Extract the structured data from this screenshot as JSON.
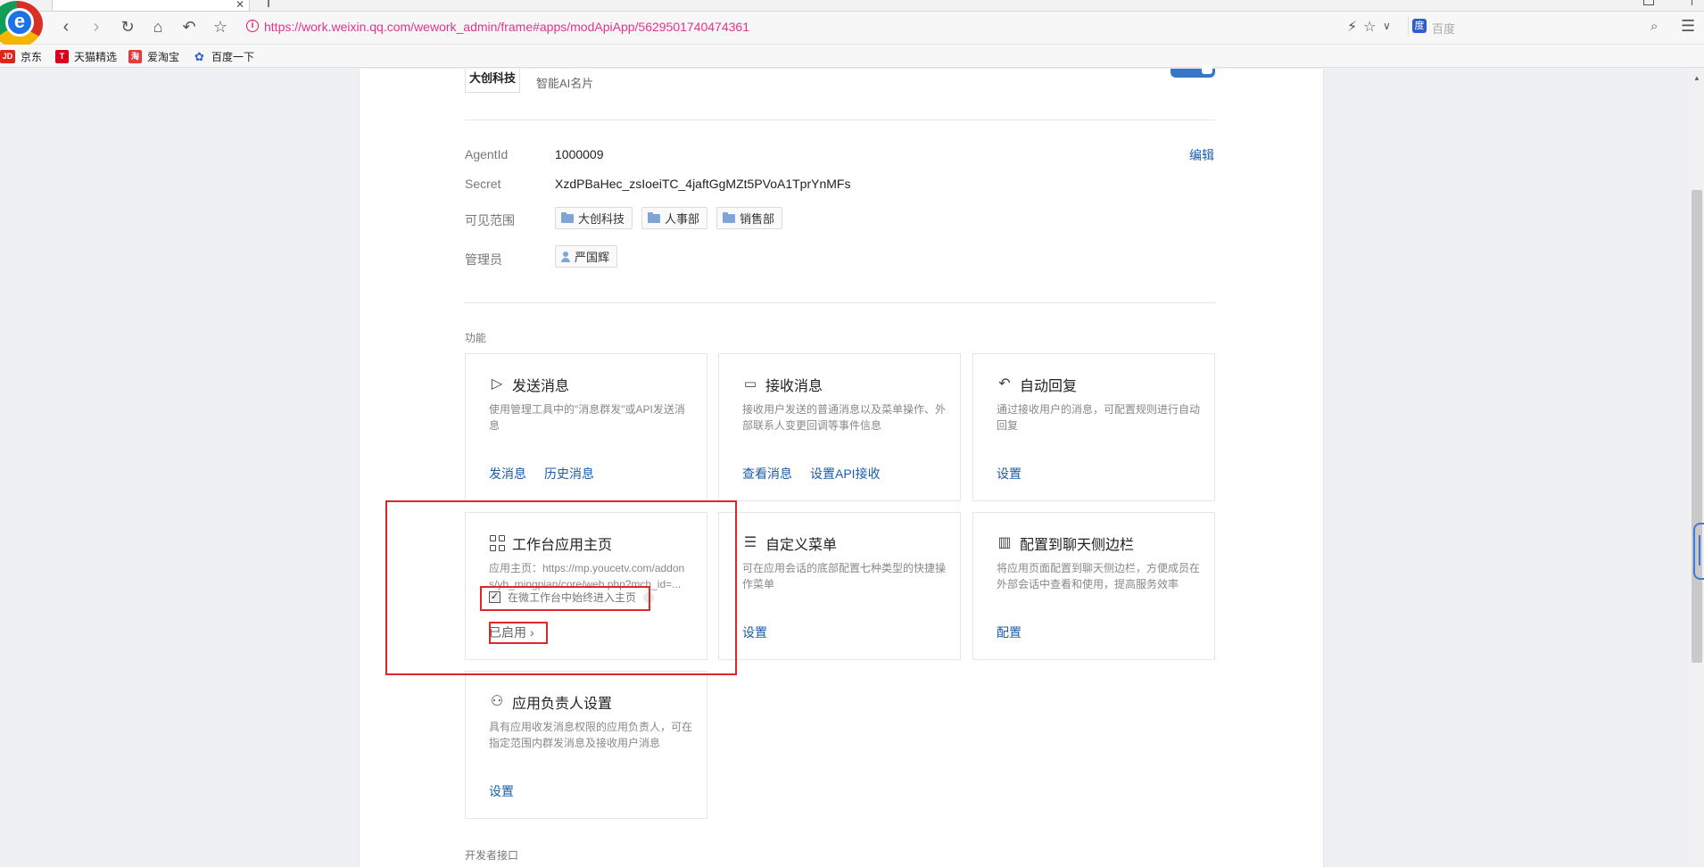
{
  "browser": {
    "url": "https://work.weixin.qq.com/wework_admin/frame#apps/modApiApp/5629501740474361",
    "search_placeholder": "百度",
    "bookmarks": [
      {
        "label": "京东",
        "icon": "jd-icon",
        "badge": "JD",
        "color": "#e1251b"
      },
      {
        "label": "天猫精选",
        "icon": "tmall-icon",
        "badge": "T",
        "color": "#d9001b"
      },
      {
        "label": "爱淘宝",
        "icon": "aitaobao-icon",
        "badge": "淘",
        "color": "#e43b3b"
      },
      {
        "label": "百度一下",
        "icon": "baidu-paw-icon",
        "badge": "",
        "color": "#2f5ccb"
      }
    ]
  },
  "app": {
    "logo_text": "大创科技",
    "description": "智能AI名片"
  },
  "info": {
    "agentid_label": "AgentId",
    "agentid_value": "1000009",
    "edit_label": "编辑",
    "secret_label": "Secret",
    "secret_value": "XzdPBaHec_zsIoeiTC_4jaftGgMZt5PVoA1TprYnMFs",
    "scope_label": "可见范围",
    "scope_tags": [
      "大创科技",
      "人事部",
      "销售部"
    ],
    "admin_label": "管理员",
    "admin_name": "严国辉"
  },
  "features": {
    "section_label": "功能",
    "send": {
      "title": "发送消息",
      "desc": "使用管理工具中的\"消息群发\"或API发送消息",
      "links": [
        "发消息",
        "历史消息"
      ]
    },
    "receive": {
      "title": "接收消息",
      "desc": "接收用户发送的普通消息以及菜单操作、外部联系人变更回调等事件信息",
      "links": [
        "查看消息",
        "设置API接收"
      ]
    },
    "autoreply": {
      "title": "自动回复",
      "desc": "通过接收用户的消息，可配置规则进行自动回复",
      "links": [
        "设置"
      ]
    },
    "homepage": {
      "title": "工作台应用主页",
      "desc": "应用主页：https://mp.youcetv.com/addons/yb_mingpian/core/web.php?mch_id=...",
      "checkbox_label": "在微工作台中始终进入主页",
      "status": "已启用"
    },
    "menu": {
      "title": "自定义菜单",
      "desc": "可在应用会话的底部配置七种类型的快捷操作菜单",
      "links": [
        "设置"
      ]
    },
    "sidebar": {
      "title": "配置到聊天侧边栏",
      "desc": "将应用页面配置到聊天侧边栏，方便成员在外部会话中查看和使用，提高服务效率",
      "links": [
        "配置"
      ]
    },
    "owner": {
      "title": "应用负责人设置",
      "desc": "具有应用收发消息权限的应用负责人，可在指定范围内群发消息及接收用户消息",
      "links": [
        "设置"
      ]
    }
  },
  "developer_section_label": "开发者接口"
}
